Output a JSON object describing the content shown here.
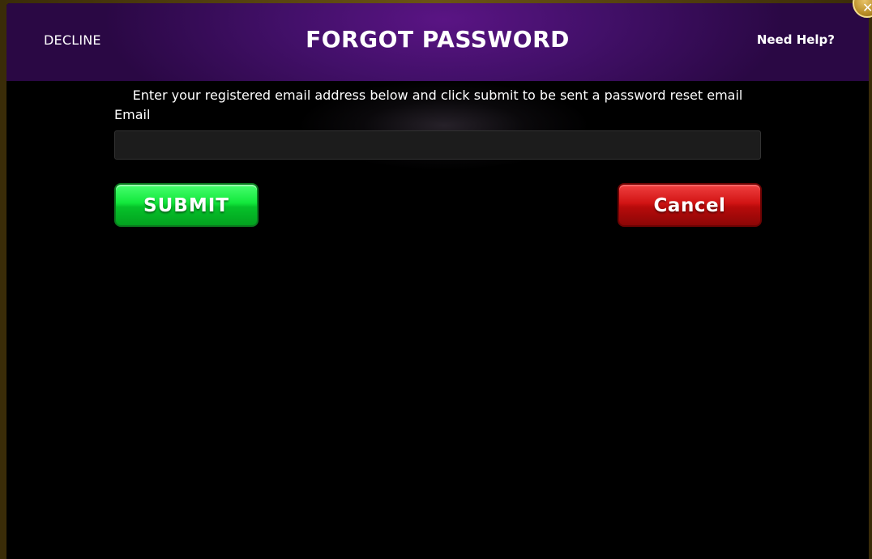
{
  "header": {
    "decline_label": "DECLINE",
    "title": "FORGOT PASSWORD",
    "help_label": "Need Help?"
  },
  "form": {
    "instructions": "Enter your registered email address below and click submit to be sent a password reset email",
    "email_label": "Email",
    "email_value": "",
    "email_placeholder": ""
  },
  "buttons": {
    "submit_label": "SUBMIT",
    "cancel_label": "Cancel"
  },
  "close": {
    "icon": "close-icon",
    "glyph": "✕"
  },
  "colors": {
    "header_purple": "#43106a",
    "submit_green": "#12e83c",
    "cancel_red": "#d21414",
    "close_gold": "#b68a23"
  }
}
